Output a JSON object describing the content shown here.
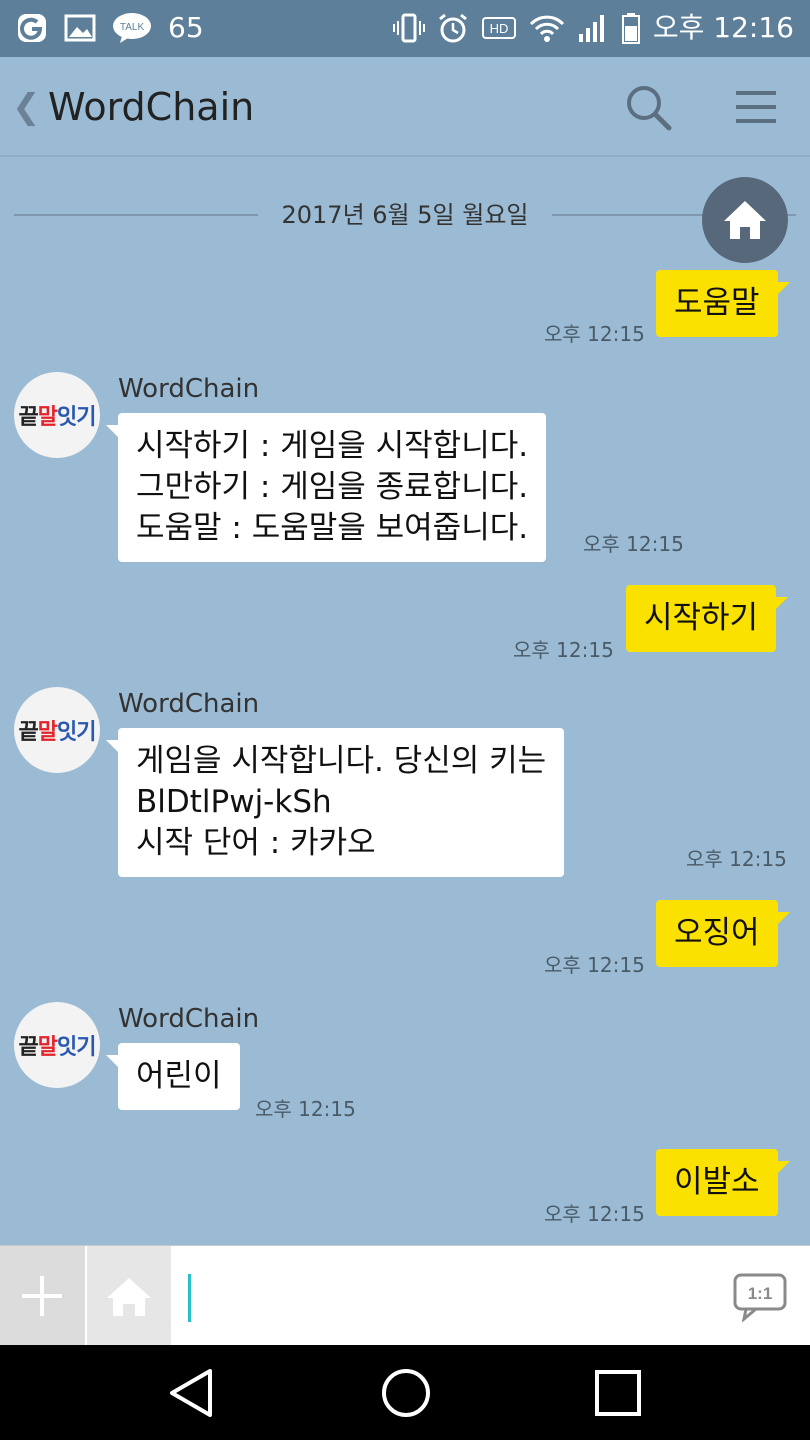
{
  "status_bar": {
    "notification_count": "65",
    "talk_label": "TALK",
    "hd_label": "HD",
    "time": "오후 12:16"
  },
  "header": {
    "title": "WordChain"
  },
  "chat": {
    "date_divider": "2017년 6월 5일 월요일",
    "messages": [
      {
        "from": "me",
        "text": "도움말",
        "time": "오후 12:15"
      },
      {
        "from": "bot",
        "sender": "WordChain",
        "text": "시작하기 : 게임을 시작합니다.\n그만하기 : 게임을 종료합니다.\n도움말 : 도움말을 보여줍니다.",
        "time": "오후 12:15"
      },
      {
        "from": "me",
        "text": "시작하기",
        "time": "오후 12:15"
      },
      {
        "from": "bot",
        "sender": "WordChain",
        "text": "게임을 시작합니다. 당신의 키는\nBlDtlPwj-kSh\n시작 단어 : 카카오",
        "time": "오후 12:15"
      },
      {
        "from": "me",
        "text": "오징어",
        "time": "오후 12:15"
      },
      {
        "from": "bot",
        "sender": "WordChain",
        "text": "어린이",
        "time": "오후 12:15"
      },
      {
        "from": "me",
        "text": "이발소",
        "time": "오후 12:15"
      }
    ],
    "bot_avatar": {
      "part1": "끝",
      "part2": "말",
      "part3": "잇기"
    }
  },
  "input_bar": {
    "text_value": "",
    "oneonone_label": "1:1"
  },
  "colors": {
    "chat_bg": "#9bbbd4",
    "my_bubble": "#fae100",
    "bot_bubble": "#ffffff",
    "status_bar": "#5d7f99"
  }
}
